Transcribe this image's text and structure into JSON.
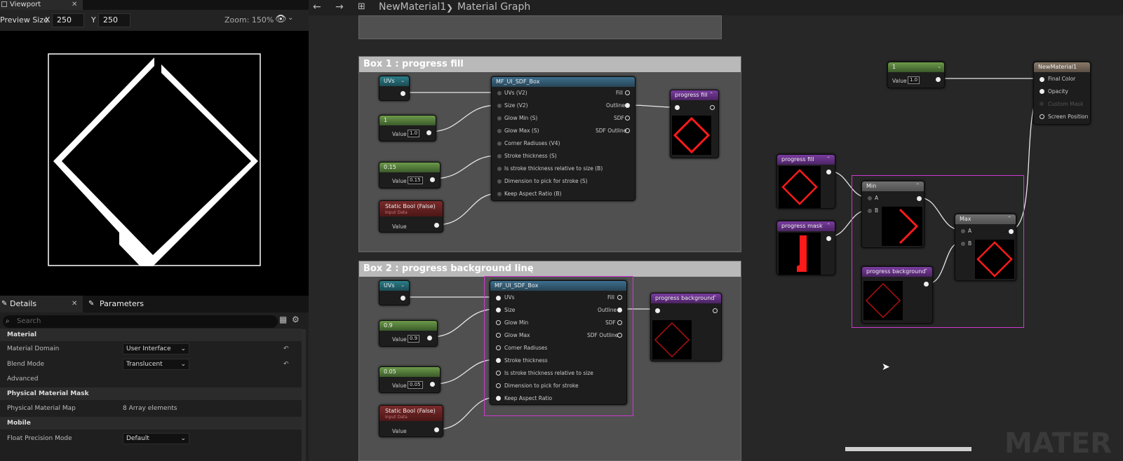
{
  "viewport_tab": {
    "title": "Viewport"
  },
  "viewport_toolbar": {
    "preview_size_label": "Preview Size",
    "x_label": "X",
    "x_value": "250",
    "y_label": "Y",
    "y_value": "250",
    "zoom": "Zoom: 150%"
  },
  "details": {
    "tabs": [
      {
        "label": "Details"
      },
      {
        "label": "Parameters"
      }
    ],
    "search_placeholder": "Search",
    "sections": [
      {
        "title": "Material"
      },
      {
        "title": "Physical Material Mask"
      },
      {
        "title": "Mobile"
      }
    ],
    "rows": [
      {
        "label": "Material Domain",
        "value": "User Interface"
      },
      {
        "label": "Blend Mode",
        "value": "Translucent"
      },
      {
        "label": "Advanced"
      },
      {
        "label": "Physical Material Map",
        "value": "8 Array elements"
      },
      {
        "label": "Float Precision Mode",
        "value": "Default"
      }
    ]
  },
  "breadcrumb": {
    "material": "NewMaterial1",
    "separator": "❯",
    "graph": "Material Graph"
  },
  "boxes": [
    {
      "title": "Box 1 : progress fill"
    },
    {
      "title": "Box 2 : progress background line"
    }
  ],
  "nodes": {
    "uvs_label": "UVs",
    "const_1": {
      "title": "1",
      "value_label": "Value",
      "value": "1.0"
    },
    "const_015": {
      "title": "0.15",
      "value_label": "Value",
      "value": "0.15"
    },
    "const_09": {
      "title": "0.9",
      "value_label": "Value",
      "value": "0.9"
    },
    "const_005": {
      "title": "0.05",
      "value_label": "Value",
      "value": "0.05"
    },
    "static_bool": {
      "title": "Static Bool (False)",
      "subtitle": "Input Data",
      "value_label": "Value"
    },
    "sdf_box_1": {
      "title": "MF_UI_SDF_Box",
      "inputs": [
        "UVs (V2)",
        "Size (V2)",
        "Glow Min (S)",
        "Glow Max (S)",
        "Corner Radiuses (V4)",
        "Stroke thickness (S)",
        "Is stroke thickness relative to size (B)",
        "Dimension to pick for stroke (S)",
        "Keep Aspect Ratio (B)"
      ],
      "outputs": [
        "Fill",
        "Outline",
        "SDF",
        "SDF Outline"
      ]
    },
    "sdf_box_2": {
      "title": "MF_UI_SDF_Box",
      "inputs": [
        "UVs",
        "Size",
        "Glow Min",
        "Glow Max",
        "Corner Radiuses",
        "Stroke thickness",
        "Is stroke thickness relative to size",
        "Dimension to pick for stroke",
        "Keep Aspect Ratio"
      ],
      "outputs": [
        "Fill",
        "Outline",
        "SDF",
        "SDF Outline"
      ]
    },
    "progress_fill": {
      "title": "progress fill"
    },
    "progress_mask": {
      "title": "progress mask"
    },
    "progress_background": {
      "title": "progress background"
    },
    "min": {
      "title": "Min",
      "a": "A",
      "b": "B"
    },
    "max": {
      "title": "Max",
      "a": "A",
      "b": "B"
    },
    "const_top": {
      "title": "1",
      "value_label": "Value",
      "value": "1.0"
    },
    "result": {
      "title": "NewMaterial1",
      "inputs": [
        "Final Color",
        "Opacity",
        "Custom Mask",
        "Screen Position"
      ]
    }
  },
  "watermark": "MATER",
  "colors": {
    "selection": "#d038d0",
    "preview_red": "#ff1a1a",
    "graph_bg": "#272727",
    "comment_body": "#505050"
  }
}
